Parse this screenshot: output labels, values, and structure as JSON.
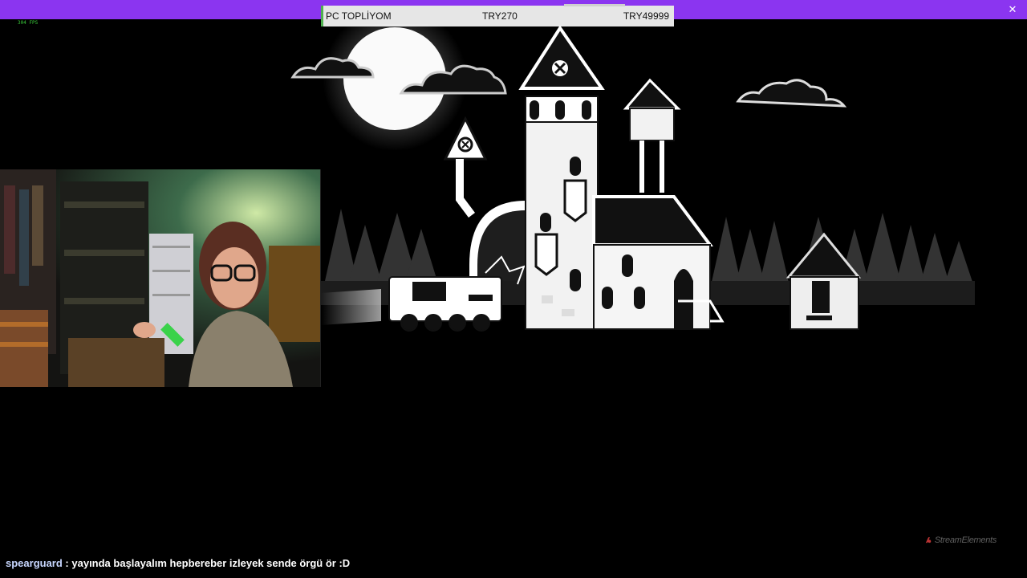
{
  "stream": {
    "fps_text": "304 FPS",
    "close_glyph": "✕"
  },
  "goal": {
    "title": "PC TOPLİYOM",
    "current": "TRY270",
    "target": "TRY49999",
    "progress_fraction": 0.0054
  },
  "chat": {
    "username": "spearguard",
    "separator": " : ",
    "message": "yayında başlayalım hepbereber izleyek sende örgü ör :D"
  },
  "brand": {
    "text": "StreamElements",
    "icon": "brand-logo-icon"
  },
  "colors": {
    "topbar": "#8b35f0",
    "goal_bg": "#e6e6e6",
    "goal_accent": "#4fb04f",
    "chat_user": "#c8d7ff"
  }
}
